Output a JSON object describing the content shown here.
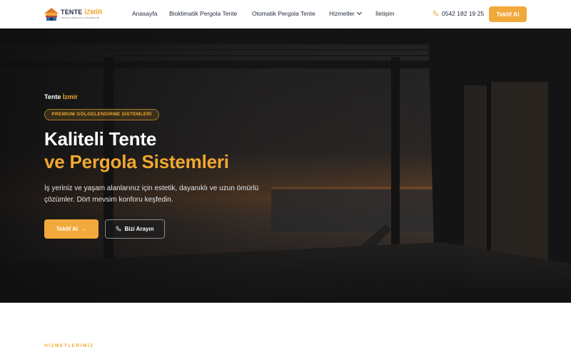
{
  "brand": {
    "name_part1": "TENTE",
    "name_part2": "İZMİR",
    "tagline": "TENTE & PERGOLA SİSTEMLERİ"
  },
  "nav": {
    "items": [
      {
        "label": "Anasayfa"
      },
      {
        "label": "Bioklimatik Pergola Tente"
      },
      {
        "label": "Otomatik Pergola Tente"
      },
      {
        "label": "Hizmetler"
      },
      {
        "label": "İletişim"
      }
    ]
  },
  "contact": {
    "phone": "0542 182 19 25"
  },
  "header": {
    "cta_label": "Teklif Al"
  },
  "hero": {
    "brand_part1": "Tente",
    "brand_part2": "İzmir",
    "badge": "PREMIUM GÖLGELENDİRME SİSTEMLERİ",
    "title_line1": "Kaliteli Tente",
    "title_line2": "ve Pergola Sistemleri",
    "description": "İş yeriniz ve yaşam alanlarınız için estetik, dayanıklı ve uzun ömürlü çözümler. Dört mevsim konforu keşfedin.",
    "primary_button": "Teklif Al",
    "secondary_button": "Bizi Arayın"
  },
  "services": {
    "eyebrow": "HİZMETLERİMİZ"
  },
  "icons": {
    "logo": "house-awning-logo",
    "phone": "phone-icon",
    "dropdown": "chevron-down-icon",
    "arrow": "arrow-right-icon"
  },
  "colors": {
    "accent": "#f2a93b",
    "dark": "#1f2937"
  }
}
